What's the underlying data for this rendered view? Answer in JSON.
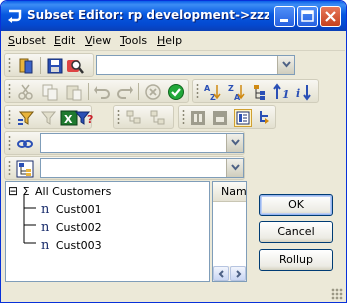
{
  "window": {
    "title": "Subset Editor:  rp development->zzz...",
    "controls": {
      "minimize": "_",
      "maximize": "□",
      "close": "✕"
    }
  },
  "menubar": {
    "items": [
      "Subset",
      "Edit",
      "View",
      "Tools",
      "Help"
    ]
  },
  "toolbar1": {
    "icons": [
      "book-icon",
      "save-icon",
      "search-icon",
      "sort-asc-icon",
      "sort-desc-icon",
      "hierarchy-sort-icon",
      "sort-level-asc-icon",
      "sort-level-desc-icon"
    ],
    "combo_value": ""
  },
  "toolbar2": {
    "icons": [
      "cut-icon",
      "copy-icon",
      "paste-icon",
      "undo-icon",
      "redo-icon",
      "cancel-icon",
      "ok-check-icon"
    ]
  },
  "toolbar3": {
    "icons": [
      "filter-level-icon",
      "filter-attribute-icon",
      "excel-icon",
      "filter-expression-icon",
      "expand-icon",
      "collapse-icon",
      "drill-icon",
      "drill-down-icon",
      "properties-icon",
      "branch-icon"
    ]
  },
  "combo_alias": {
    "value": ""
  },
  "combo_subset": {
    "value": ""
  },
  "tree": {
    "root": {
      "expander": "⊟",
      "symbol": "Σ",
      "label": "All Customers"
    },
    "children": [
      {
        "symbol": "n",
        "label": "Cust001"
      },
      {
        "symbol": "n",
        "label": "Cust002"
      },
      {
        "symbol": "n",
        "label": "Cust003"
      }
    ]
  },
  "grid": {
    "column_header": "Name"
  },
  "buttons": {
    "ok": "OK",
    "cancel": "Cancel",
    "rollup": "Rollup"
  },
  "colors": {
    "title_bar": "#0758e0",
    "window_bg": "#ece9d8",
    "border": "#7f9db9"
  }
}
